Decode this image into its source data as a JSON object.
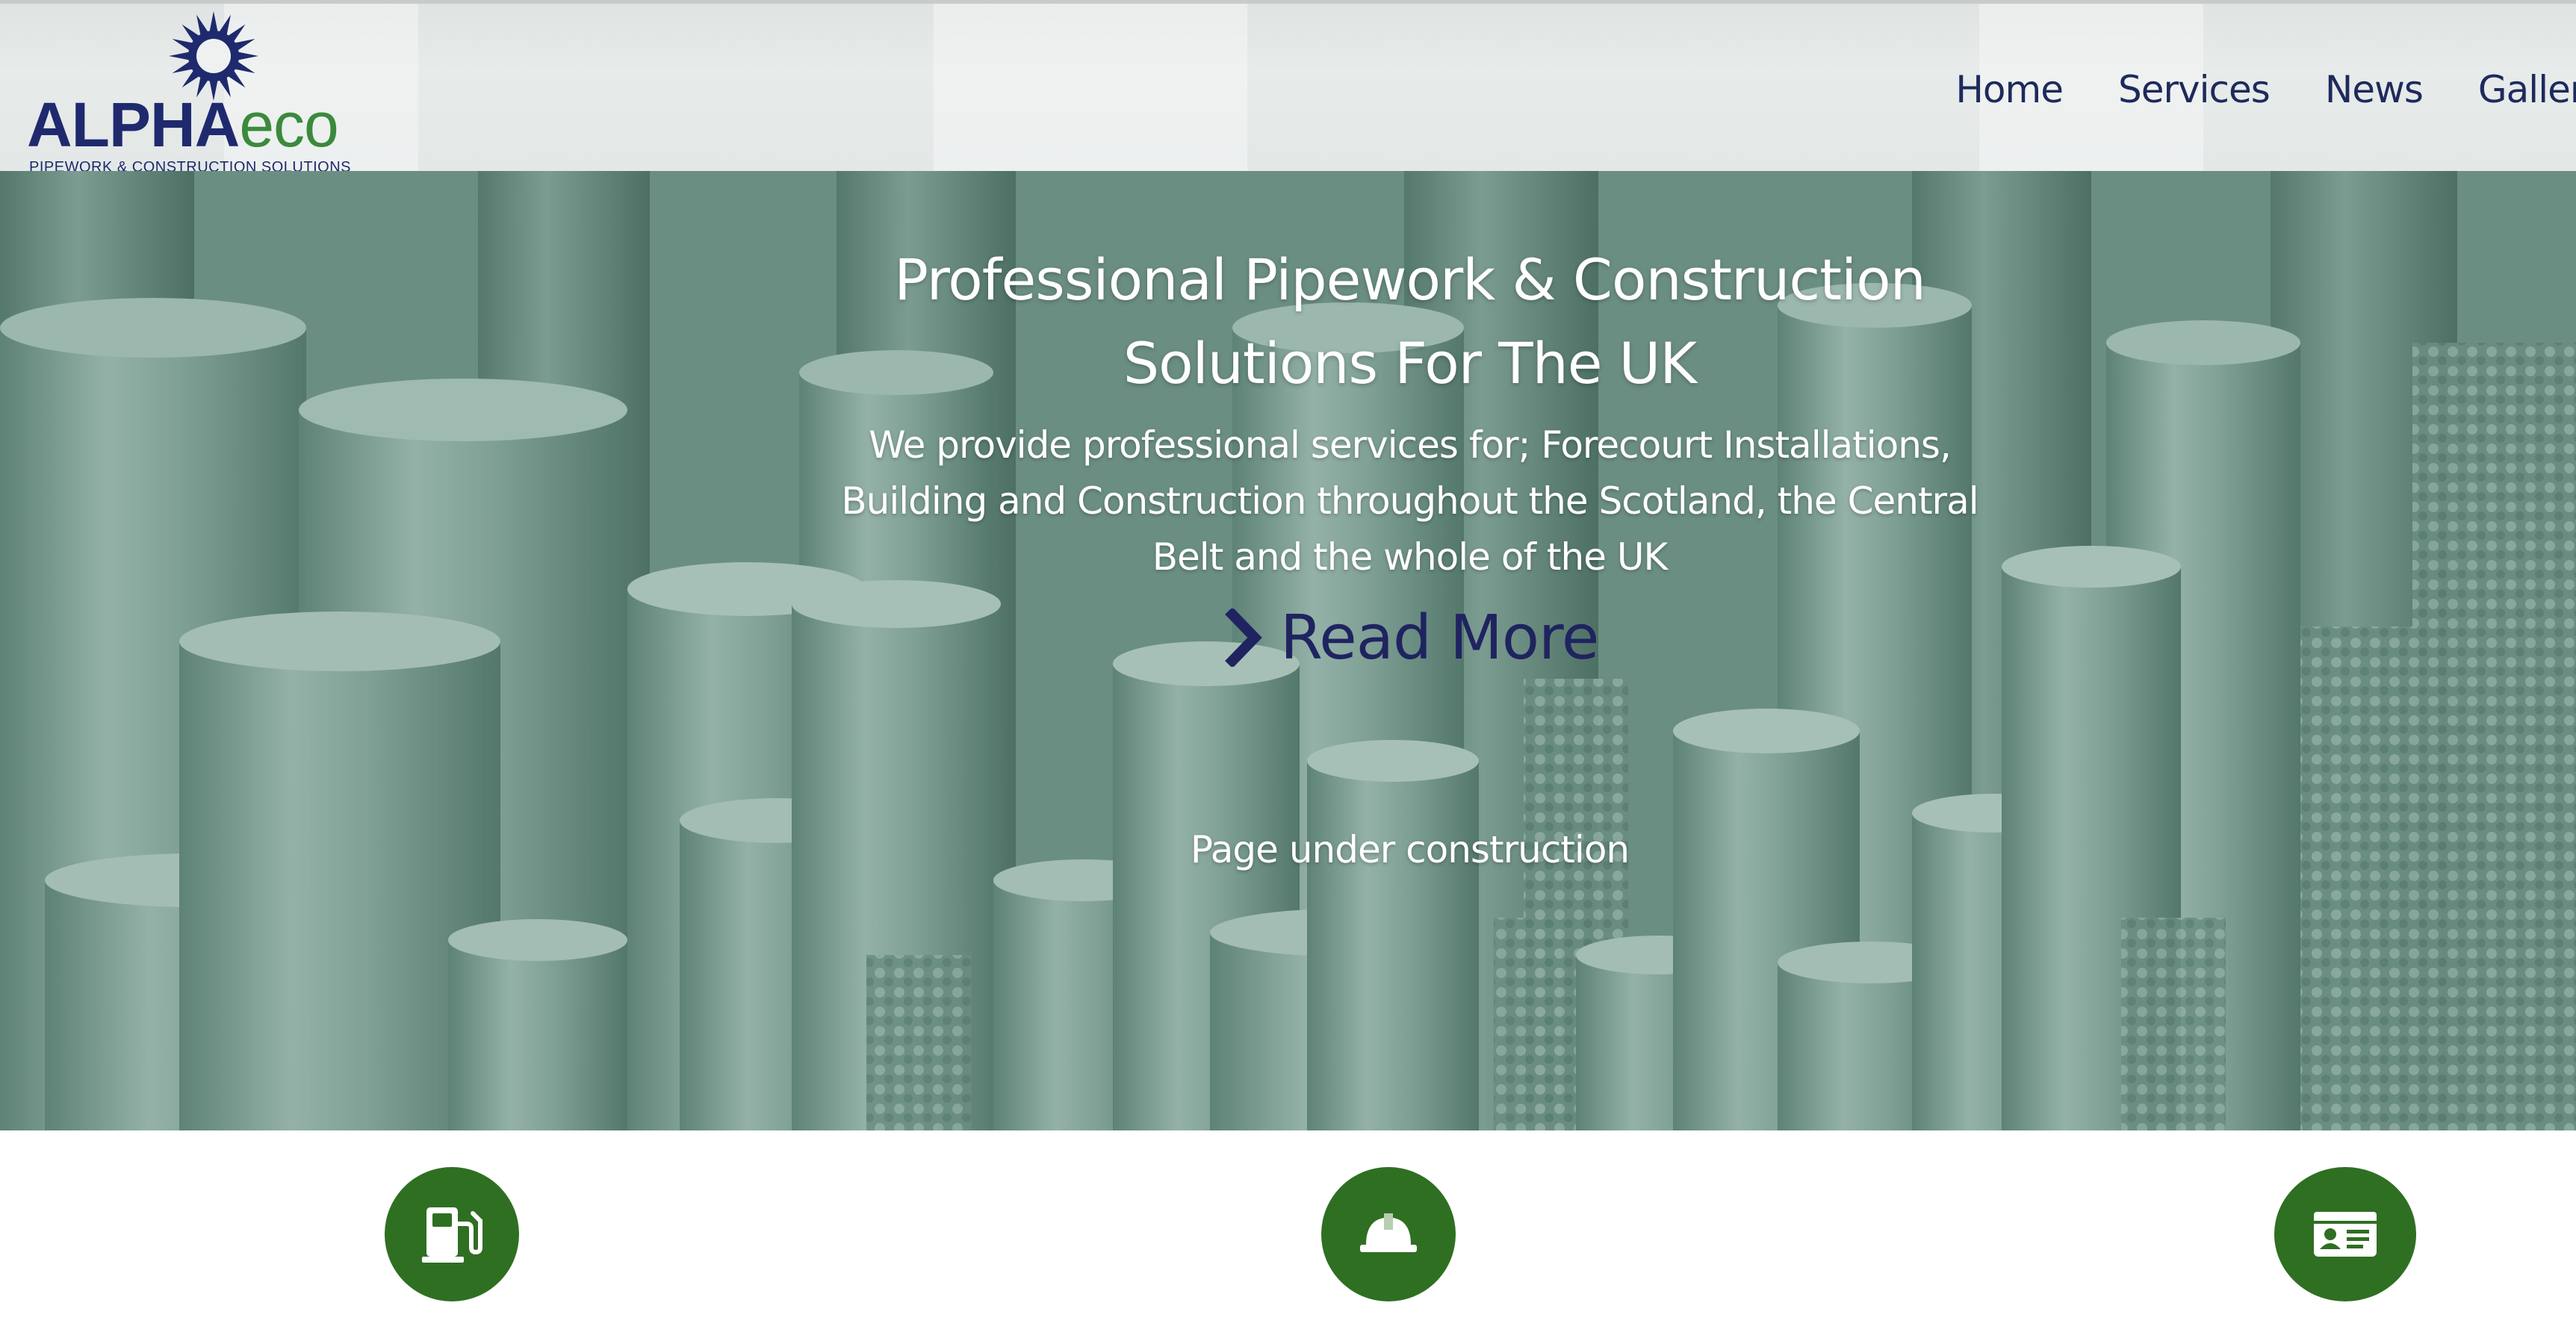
{
  "logo": {
    "alpha": "ALPHA",
    "eco": "eco",
    "tagline": "PIPEWORK & CONSTRUCTION SOLUTIONS"
  },
  "nav": {
    "items": [
      {
        "label": "Home"
      },
      {
        "label": "Services"
      },
      {
        "label": "News"
      },
      {
        "label": "Gallery"
      }
    ]
  },
  "hero": {
    "title": "Professional Pipework & Construction Solutions For The UK",
    "subtitle": "We provide professional services for; Forecourt Installations, Building and Construction throughout the Scotland, the Central Belt and the whole of the UK",
    "read_more": "Read More",
    "notice": "Page under construction"
  },
  "services": [
    {
      "icon": "fuel-pump-icon"
    },
    {
      "icon": "hard-hat-icon"
    },
    {
      "icon": "id-card-icon"
    }
  ],
  "colors": {
    "brand_navy": "#1f2a6e",
    "brand_green": "#3b8a3c",
    "icon_circle": "#2f6f22",
    "hero_tint": "#7d9a90"
  }
}
